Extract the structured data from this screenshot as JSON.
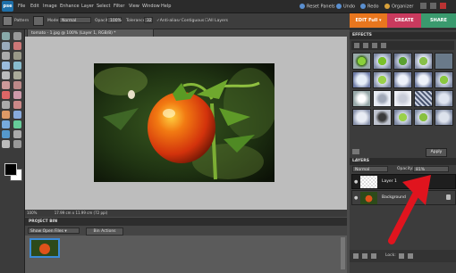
{
  "app": {
    "logo_text": "pse"
  },
  "menubar": {
    "items": [
      "File",
      "Edit",
      "Image",
      "Enhance",
      "Layer",
      "Select",
      "Filter",
      "View",
      "Window",
      "Help"
    ],
    "right_links": [
      "Reset Panels",
      "Undo",
      "Redo",
      "Organizer"
    ]
  },
  "options": {
    "pattern_label": "Pattern",
    "mode_label": "Mode:",
    "mode_value": "Normal",
    "opacity_label": "Opacity:",
    "opacity_value": "100%",
    "tolerance_label": "Tolerance:",
    "tolerance_value": "32",
    "antialias_label": "Anti-alias",
    "contiguous_label": "Contiguous",
    "all_layers_label": "All Layers"
  },
  "tabs": {
    "edit_full": "EDIT Full",
    "create": "CREATE",
    "share": "SHARE"
  },
  "document": {
    "tab_title": "tomato - 1.jpg @ 100% (Layer 1, RGB/8) *",
    "zoom": "100%",
    "status": "17.99 cm x 11.99 cm (72 ppi)"
  },
  "project_bin": {
    "title": "PROJECT BIN",
    "show_value": "Show Open Files",
    "actions_label": "Bin Actions"
  },
  "effects": {
    "title": "EFFECTS",
    "apply_label": "Apply"
  },
  "layers": {
    "title": "LAYERS",
    "blend_mode": "Normal",
    "opacity_label": "Opacity:",
    "opacity_value": "81%",
    "items": [
      {
        "name": "Layer 1",
        "selected": true
      },
      {
        "name": "Background",
        "selected": false,
        "locked": true
      }
    ],
    "lock_label": "Lock:"
  },
  "colors": {
    "accent": "#e8761e",
    "create": "#c93a5e",
    "share": "#3a9a6e",
    "arrow": "#e0141e"
  }
}
